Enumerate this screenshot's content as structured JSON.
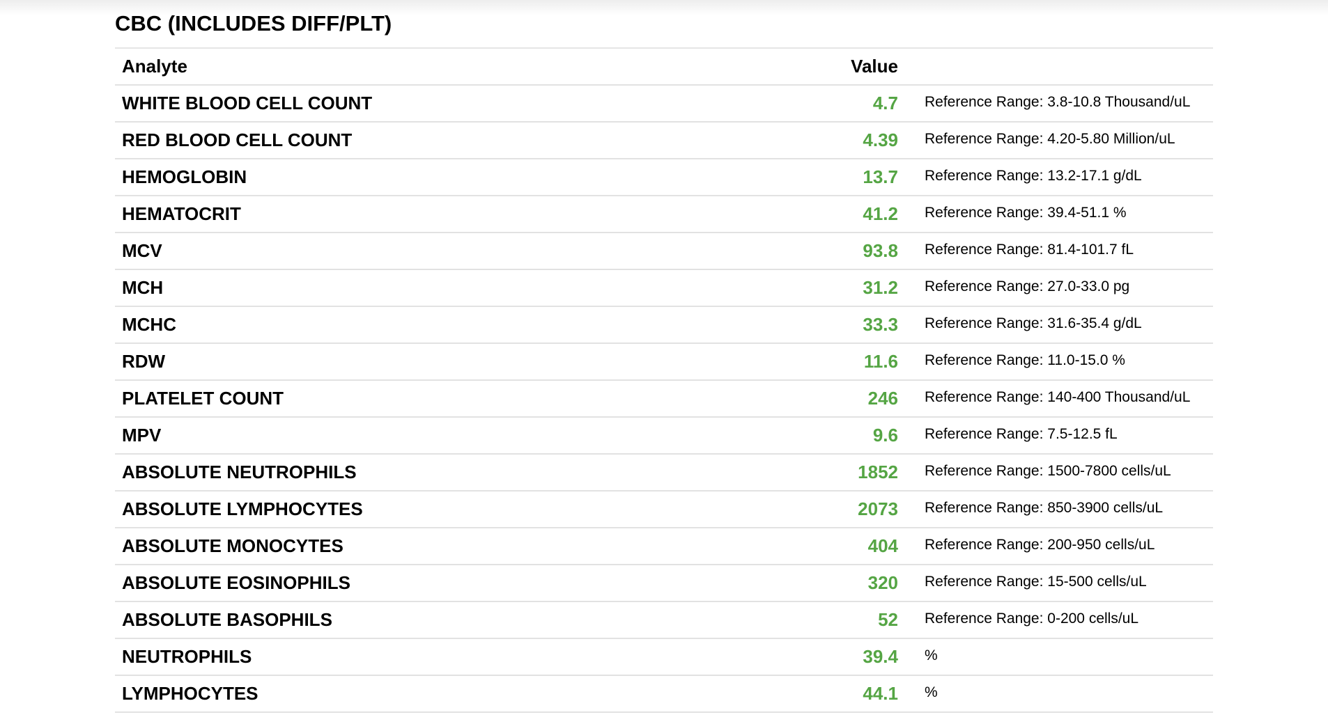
{
  "section_title": "CBC (INCLUDES DIFF/PLT)",
  "table": {
    "headers": {
      "analyte": "Analyte",
      "value": "Value",
      "range": ""
    },
    "rows": [
      {
        "analyte": "WHITE BLOOD CELL COUNT",
        "value": "4.7",
        "range": "Reference Range: 3.8-10.8 Thousand/uL"
      },
      {
        "analyte": "RED BLOOD CELL COUNT",
        "value": "4.39",
        "range": "Reference Range: 4.20-5.80 Million/uL"
      },
      {
        "analyte": "HEMOGLOBIN",
        "value": "13.7",
        "range": "Reference Range: 13.2-17.1 g/dL"
      },
      {
        "analyte": "HEMATOCRIT",
        "value": "41.2",
        "range": "Reference Range: 39.4-51.1 %"
      },
      {
        "analyte": "MCV",
        "value": "93.8",
        "range": "Reference Range: 81.4-101.7 fL"
      },
      {
        "analyte": "MCH",
        "value": "31.2",
        "range": "Reference Range: 27.0-33.0 pg"
      },
      {
        "analyte": "MCHC",
        "value": "33.3",
        "range": "Reference Range: 31.6-35.4 g/dL"
      },
      {
        "analyte": "RDW",
        "value": "11.6",
        "range": "Reference Range: 11.0-15.0 %"
      },
      {
        "analyte": "PLATELET COUNT",
        "value": "246",
        "range": "Reference Range: 140-400 Thousand/uL"
      },
      {
        "analyte": "MPV",
        "value": "9.6",
        "range": "Reference Range: 7.5-12.5 fL"
      },
      {
        "analyte": "ABSOLUTE NEUTROPHILS",
        "value": "1852",
        "range": "Reference Range: 1500-7800 cells/uL"
      },
      {
        "analyte": "ABSOLUTE LYMPHOCYTES",
        "value": "2073",
        "range": "Reference Range: 850-3900 cells/uL"
      },
      {
        "analyte": "ABSOLUTE MONOCYTES",
        "value": "404",
        "range": "Reference Range: 200-950 cells/uL"
      },
      {
        "analyte": "ABSOLUTE EOSINOPHILS",
        "value": "320",
        "range": "Reference Range: 15-500 cells/uL"
      },
      {
        "analyte": "ABSOLUTE BASOPHILS",
        "value": "52",
        "range": "Reference Range: 0-200 cells/uL"
      },
      {
        "analyte": "NEUTROPHILS",
        "value": "39.4",
        "range": "%"
      },
      {
        "analyte": "LYMPHOCYTES",
        "value": "44.1",
        "range": "%"
      }
    ]
  },
  "colors": {
    "value_normal": "#55a544",
    "divider": "#e2e2e2"
  }
}
